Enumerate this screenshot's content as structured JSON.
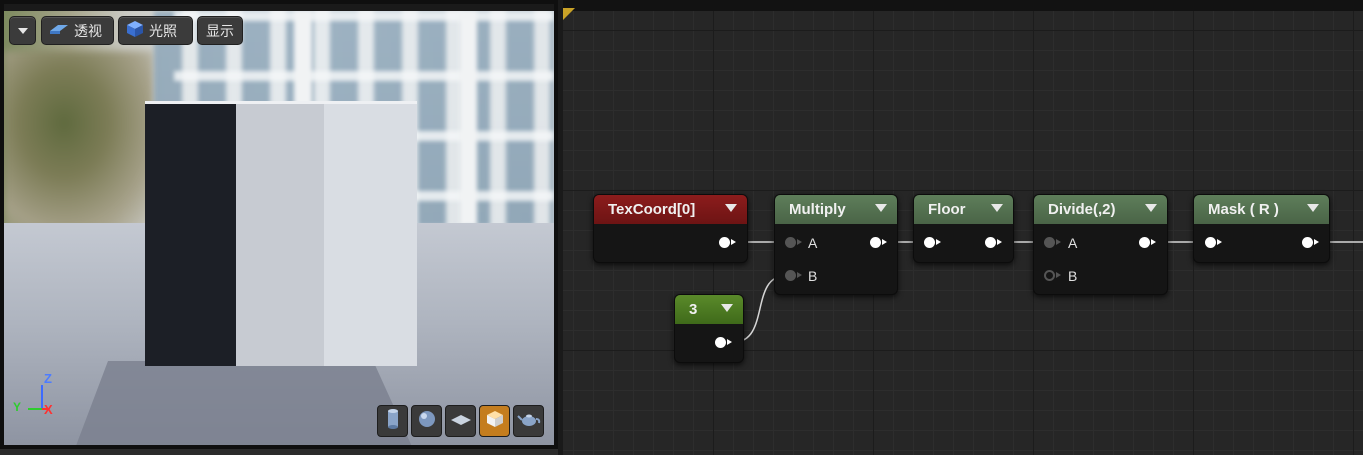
{
  "viewport": {
    "toolbar": {
      "dropdown_icon": "chevron-down-icon",
      "perspective_label": "透视",
      "lighting_label": "光照",
      "show_label": "显示"
    },
    "axes": {
      "z": "Z",
      "y": "Y",
      "x": "X"
    },
    "preview_buttons": [
      "cylinder-icon",
      "sphere-icon",
      "plane-icon",
      "cube-icon",
      "teapot-icon"
    ],
    "active_preview": "cube-icon"
  },
  "graph": {
    "nodes": {
      "texcoord": {
        "title": "TexCoord[0]"
      },
      "multiply": {
        "title": "Multiply",
        "inputs": [
          "A",
          "B"
        ]
      },
      "floor": {
        "title": "Floor"
      },
      "divide": {
        "title": "Divide(,2)",
        "inputs": [
          "A",
          "B"
        ]
      },
      "mask": {
        "title": "Mask ( R )"
      },
      "constant": {
        "title": "3"
      }
    }
  },
  "colors": {
    "texcoord_header": "#8c1c1c",
    "function_header": "#5e7e5a",
    "constant_header": "#5a8a2a",
    "active_preview": "#c47d1e"
  }
}
